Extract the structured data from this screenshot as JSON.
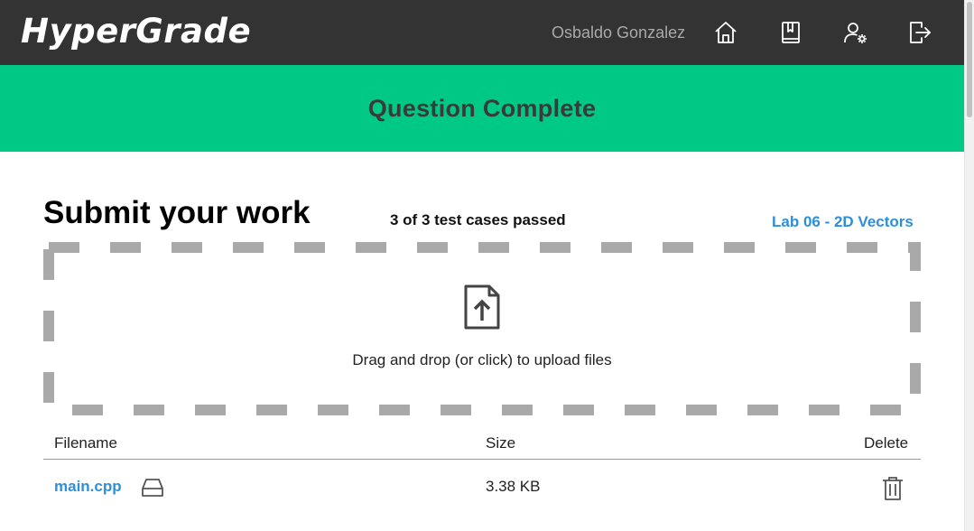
{
  "header": {
    "logo": "HyperGrade",
    "username": "Osbaldo Gonzalez",
    "nav_icons": [
      "home-icon",
      "gradebook-icon",
      "user-settings-icon",
      "logout-icon"
    ]
  },
  "banner": {
    "text": "Question Complete",
    "color": "#00c985"
  },
  "submit": {
    "title": "Submit your work",
    "tests_passed": "3 of 3 test cases passed",
    "lab_link": "Lab 06 - 2D Vectors"
  },
  "dropzone": {
    "text": "Drag and drop (or click) to upload files",
    "icon": "file-upload-icon"
  },
  "files_table": {
    "columns": {
      "filename": "Filename",
      "size": "Size",
      "delete": "Delete"
    },
    "rows": [
      {
        "filename": "main.cpp",
        "size": "3.38 KB",
        "view_icon": "drive-icon",
        "delete_icon": "trash-icon"
      }
    ]
  },
  "colors": {
    "header_bg": "#333333",
    "accent_link": "#2e8fd8",
    "banner_green": "#00c985"
  }
}
